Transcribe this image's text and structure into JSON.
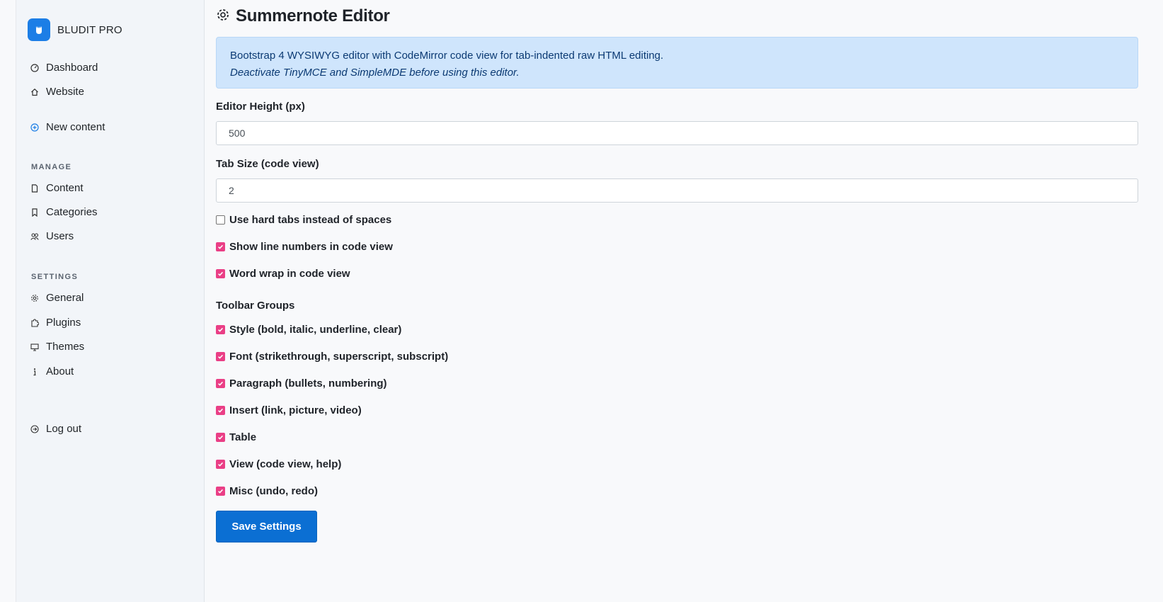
{
  "colors": {
    "accent": "#1c7ee6",
    "checkbox": "#ea3f86",
    "primary_button": "#0b6fd3",
    "alert_bg": "#cfe5fc"
  },
  "sidebar": {
    "brand": {
      "logo_icon": "bludit-logo-icon",
      "name": "BLUDIT PRO"
    },
    "top_items": [
      {
        "label": "Dashboard",
        "icon": "gauge-icon"
      },
      {
        "label": "Website",
        "icon": "home-icon"
      },
      {
        "label": "New content",
        "icon": "plus-circle-icon"
      }
    ],
    "manage": {
      "heading": "MANAGE",
      "items": [
        {
          "label": "Content",
          "icon": "document-icon"
        },
        {
          "label": "Categories",
          "icon": "bookmark-icon"
        },
        {
          "label": "Users",
          "icon": "users-icon"
        }
      ]
    },
    "settings": {
      "heading": "SETTINGS",
      "items": [
        {
          "label": "General",
          "icon": "gear-icon"
        },
        {
          "label": "Plugins",
          "icon": "puzzle-icon"
        },
        {
          "label": "Themes",
          "icon": "monitor-icon"
        },
        {
          "label": "About",
          "icon": "info-icon"
        }
      ]
    },
    "logout": {
      "label": "Log out",
      "icon": "logout-icon"
    }
  },
  "main": {
    "title": "Summernote Editor",
    "title_icon": "gear-icon",
    "alert": {
      "line1": "Bootstrap 4 WYSIWYG editor with CodeMirror code view for tab-indented raw HTML editing.",
      "line2": "Deactivate TinyMCE and SimpleMDE before using this editor."
    },
    "editor_height": {
      "label": "Editor Height (px)",
      "value": "500"
    },
    "tab_size": {
      "label": "Tab Size (code view)",
      "value": "2"
    },
    "options": [
      {
        "label": "Use hard tabs instead of spaces",
        "checked": false
      },
      {
        "label": "Show line numbers in code view",
        "checked": true
      },
      {
        "label": "Word wrap in code view",
        "checked": true
      }
    ],
    "toolbar_groups": {
      "heading": "Toolbar Groups",
      "items": [
        {
          "label": "Style (bold, italic, underline, clear)",
          "checked": true
        },
        {
          "label": "Font (strikethrough, superscript, subscript)",
          "checked": true
        },
        {
          "label": "Paragraph (bullets, numbering)",
          "checked": true
        },
        {
          "label": "Insert (link, picture, video)",
          "checked": true
        },
        {
          "label": "Table",
          "checked": true
        },
        {
          "label": "View (code view, help)",
          "checked": true
        },
        {
          "label": "Misc (undo, redo)",
          "checked": true
        }
      ]
    },
    "save_label": "Save Settings"
  }
}
